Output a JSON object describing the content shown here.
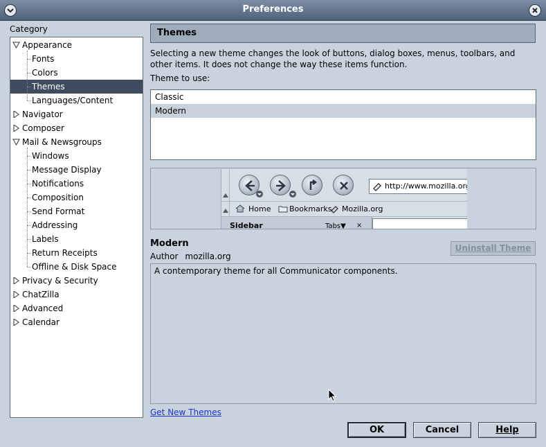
{
  "window": {
    "title": "Preferences"
  },
  "category_label": "Category",
  "tree": [
    {
      "label": "Appearance",
      "level": 0,
      "twisty": "open"
    },
    {
      "label": "Fonts",
      "level": 1
    },
    {
      "label": "Colors",
      "level": 1
    },
    {
      "label": "Themes",
      "level": 1,
      "selected": true
    },
    {
      "label": "Languages/Content",
      "level": 1
    },
    {
      "label": "Navigator",
      "level": 0,
      "twisty": "closed"
    },
    {
      "label": "Composer",
      "level": 0,
      "twisty": "closed"
    },
    {
      "label": "Mail & Newsgroups",
      "level": 0,
      "twisty": "open"
    },
    {
      "label": "Windows",
      "level": 1
    },
    {
      "label": "Message Display",
      "level": 1
    },
    {
      "label": "Notifications",
      "level": 1
    },
    {
      "label": "Composition",
      "level": 1
    },
    {
      "label": "Send Format",
      "level": 1
    },
    {
      "label": "Addressing",
      "level": 1
    },
    {
      "label": "Labels",
      "level": 1
    },
    {
      "label": "Return Receipts",
      "level": 1
    },
    {
      "label": "Offline & Disk Space",
      "level": 1
    },
    {
      "label": "Privacy & Security",
      "level": 0,
      "twisty": "closed"
    },
    {
      "label": "ChatZilla",
      "level": 0,
      "twisty": "closed"
    },
    {
      "label": "Advanced",
      "level": 0,
      "twisty": "closed"
    },
    {
      "label": "Calendar",
      "level": 0,
      "twisty": "closed"
    }
  ],
  "panel": {
    "header": "Themes",
    "description": "Selecting a new theme changes the look of buttons, dialog boxes, menus, toolbars, and other items. It does not change the way these items function.",
    "theme_to_use_label": "Theme to use:",
    "themes": [
      {
        "label": "Classic",
        "selected": false
      },
      {
        "label": "Modern",
        "selected": true
      }
    ]
  },
  "preview": {
    "url": "http://www.mozilla.org/",
    "home": "Home",
    "bookmarks": "Bookmarks",
    "mozilla_org": "Mozilla.org",
    "sidebar": "Sidebar",
    "tabs": "Tabs▼",
    "close": "×"
  },
  "selected_theme": {
    "name": "Modern",
    "author_label": "Author",
    "author": "mozilla.org",
    "description": "A contemporary theme for all Communicator components.",
    "uninstall_label": "Uninstall Theme"
  },
  "get_new_themes": "Get New Themes",
  "buttons": {
    "ok": "OK",
    "cancel": "Cancel",
    "help": "Help"
  },
  "icons": {
    "menu": "chevron-down-icon",
    "close": "close-icon",
    "back": "back-arrow-icon",
    "forward": "forward-arrow-icon",
    "reload": "reload-icon",
    "stop": "stop-icon",
    "home": "home-icon",
    "folder": "folder-icon",
    "bookmark": "bookmark-icon",
    "cursor": "mouse-pointer-icon"
  },
  "colors": {
    "selection": "#3f4c5f",
    "link": "#1a34c8",
    "titlebar": "#4f627a"
  }
}
